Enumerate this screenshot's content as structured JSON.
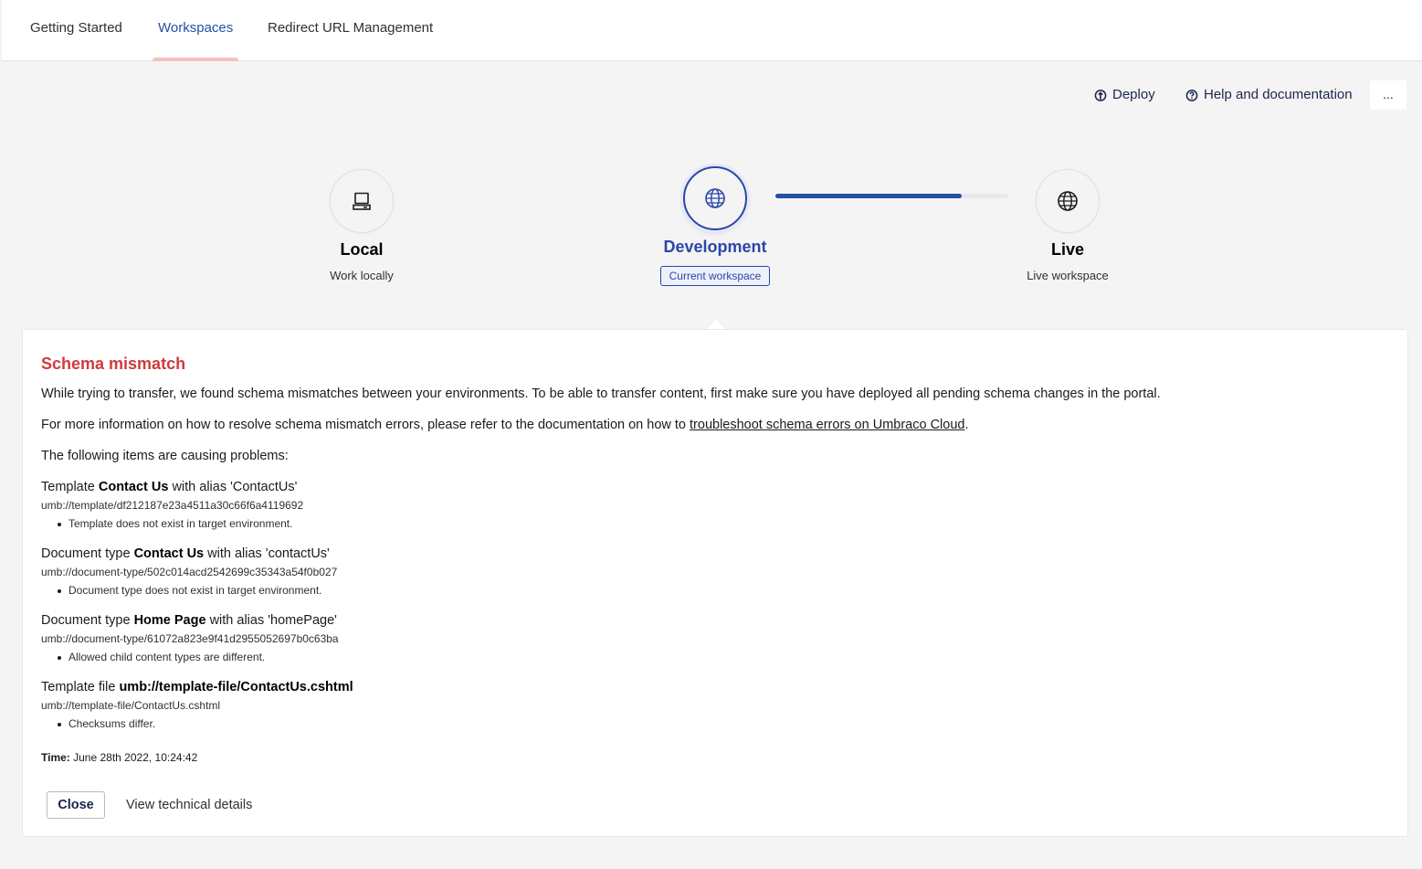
{
  "tabs": [
    {
      "label": "Getting Started"
    },
    {
      "label": "Workspaces",
      "active": true
    },
    {
      "label": "Redirect URL Management"
    }
  ],
  "actions": {
    "deploy": "Deploy",
    "help": "Help and documentation",
    "more": "..."
  },
  "workspaces": {
    "local": {
      "name": "Local",
      "description": "Work locally",
      "icon": "laptop-icon"
    },
    "development": {
      "name": "Development",
      "badge": "Current workspace",
      "icon": "globe-icon"
    },
    "live": {
      "name": "Live",
      "description": "Live workspace",
      "icon": "globe-icon"
    },
    "progress": 0.8
  },
  "error": {
    "title": "Schema mismatch",
    "intro": "While trying to transfer, we found schema mismatches between your environments. To be able to transfer content, first make sure you have deployed all pending schema changes in the portal.",
    "info_prefix": "For more information on how to resolve schema mismatch errors, please refer to the documentation on how to ",
    "info_link": "troubleshoot schema errors on Umbraco Cloud",
    "info_suffix": ".",
    "problems_label": "The following items are causing problems:",
    "items": [
      {
        "type": "Template ",
        "name": "Contact Us",
        "alias": " with alias 'ContactUs'",
        "udi": "umb://template/df212187e23a4511a30c66f6a4119692",
        "issue": "Template does not exist in target environment."
      },
      {
        "type": "Document type ",
        "name": "Contact Us",
        "alias": " with alias 'contactUs'",
        "udi": "umb://document-type/502c014acd2542699c35343a54f0b027",
        "issue": "Document type does not exist in target environment."
      },
      {
        "type": "Document type ",
        "name": "Home Page",
        "alias": " with alias 'homePage'",
        "udi": "umb://document-type/61072a823e9f41d2955052697b0c63ba",
        "issue": "Allowed child content types are different."
      },
      {
        "type": "Template file ",
        "name": "umb://template-file/ContactUs.cshtml",
        "alias": "",
        "udi": "umb://template-file/ContactUs.cshtml",
        "issue": "Checksums differ."
      }
    ],
    "time_label": "Time:",
    "time_value": " June 28th 2022, 10:24:42",
    "close_label": "Close",
    "details_label": "View technical details"
  },
  "colors": {
    "accent": "#2b46a8",
    "progress": "#2152a3",
    "error": "#cf3b3b",
    "tab_indicator": "#f5c1bc"
  }
}
